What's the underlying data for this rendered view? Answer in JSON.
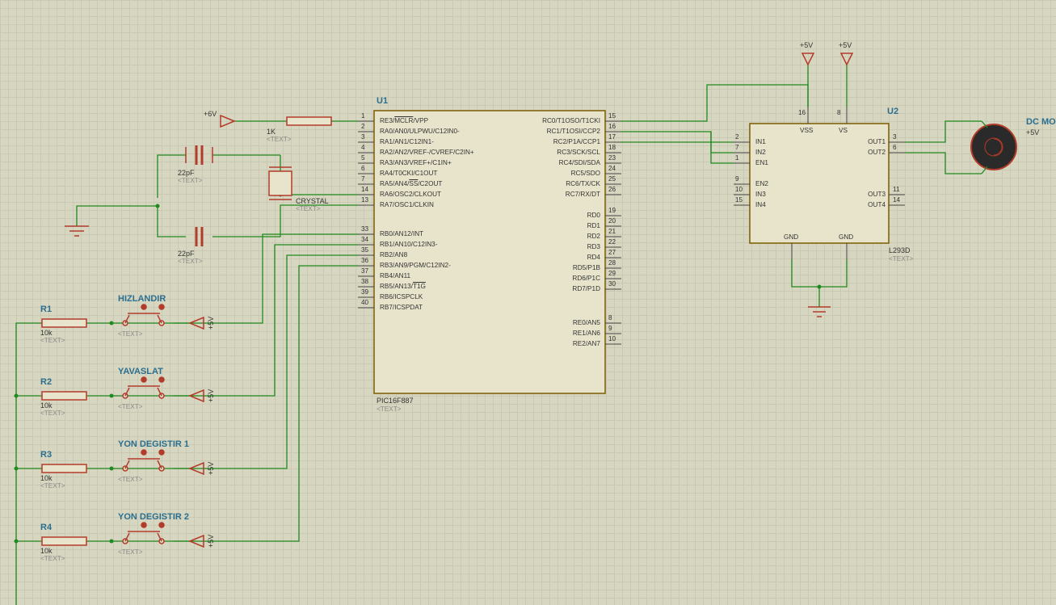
{
  "refs": {
    "U1": "U1",
    "U2": "U2",
    "R1": "R1",
    "R2": "R2",
    "R3": "R3",
    "R4": "R4"
  },
  "values": {
    "U1_part": "PIC16F887",
    "U2_part": "L293D",
    "R_10k": "10k",
    "R_1k": "1K",
    "cap_22pF_top": "22pF",
    "cap_22pF_bot": "22pF",
    "crystal": "CRYSTAL",
    "text_placeholder": "<TEXT>"
  },
  "buttons": {
    "b1": "HIZLANDIR",
    "b2": "YAVASLAT",
    "b3": "YON DEGISTIR 1",
    "b4": "YON DEGISTIR 2"
  },
  "power": {
    "p5v": "+5V",
    "p6v": "+6V"
  },
  "motor": {
    "title": "DC MOTO",
    "sub": "+5V"
  },
  "U1_pins_left": [
    {
      "n": "1",
      "name": "RE3/MCLR/VPP",
      "over": "MCLR"
    },
    {
      "n": "2",
      "name": "RA0/AN0/ULPWU/C12IN0-"
    },
    {
      "n": "3",
      "name": "RA1/AN1/C12IN1-"
    },
    {
      "n": "4",
      "name": "RA2/AN2/VREF-/CVREF/C2IN+"
    },
    {
      "n": "5",
      "name": "RA3/AN3/VREF+/C1IN+"
    },
    {
      "n": "6",
      "name": "RA4/T0CKI/C1OUT"
    },
    {
      "n": "7",
      "name": "RA5/AN4/SS/C2OUT",
      "over": "SS"
    },
    {
      "n": "14",
      "name": "RA6/OSC2/CLKOUT"
    },
    {
      "n": "13",
      "name": "RA7/OSC1/CLKIN"
    },
    {
      "n": "33",
      "name": "RB0/AN12/INT"
    },
    {
      "n": "34",
      "name": "RB1/AN10/C12IN3-"
    },
    {
      "n": "35",
      "name": "RB2/AN8"
    },
    {
      "n": "36",
      "name": "RB3/AN9/PGM/C12IN2-"
    },
    {
      "n": "37",
      "name": "RB4/AN11"
    },
    {
      "n": "38",
      "name": "RB5/AN13/T1G",
      "over": "T1G"
    },
    {
      "n": "39",
      "name": "RB6/ICSPCLK"
    },
    {
      "n": "40",
      "name": "RB7/ICSPDAT"
    }
  ],
  "U1_pins_right": [
    {
      "n": "15",
      "name": "RC0/T1OSO/T1CKI"
    },
    {
      "n": "16",
      "name": "RC1/T1OSI/CCP2"
    },
    {
      "n": "17",
      "name": "RC2/P1A/CCP1"
    },
    {
      "n": "18",
      "name": "RC3/SCK/SCL"
    },
    {
      "n": "23",
      "name": "RC4/SDI/SDA"
    },
    {
      "n": "24",
      "name": "RC5/SDO"
    },
    {
      "n": "25",
      "name": "RC6/TX/CK"
    },
    {
      "n": "26",
      "name": "RC7/RX/DT"
    },
    {
      "n": "19",
      "name": "RD0"
    },
    {
      "n": "20",
      "name": "RD1"
    },
    {
      "n": "21",
      "name": "RD2"
    },
    {
      "n": "22",
      "name": "RD3"
    },
    {
      "n": "27",
      "name": "RD4"
    },
    {
      "n": "28",
      "name": "RD5/P1B"
    },
    {
      "n": "29",
      "name": "RD6/P1C"
    },
    {
      "n": "30",
      "name": "RD7/P1D"
    },
    {
      "n": "8",
      "name": "RE0/AN5"
    },
    {
      "n": "9",
      "name": "RE1/AN6"
    },
    {
      "n": "10",
      "name": "RE2/AN7"
    }
  ],
  "U2_pins_left": [
    {
      "n": "2",
      "name": "IN1"
    },
    {
      "n": "7",
      "name": "IN2"
    },
    {
      "n": "1",
      "name": "EN1"
    },
    {
      "n": "9",
      "name": "EN2"
    },
    {
      "n": "10",
      "name": "IN3"
    },
    {
      "n": "15",
      "name": "IN4"
    }
  ],
  "U2_pins_right": [
    {
      "n": "3",
      "name": "OUT1"
    },
    {
      "n": "6",
      "name": "OUT2"
    },
    {
      "n": "11",
      "name": "OUT3"
    },
    {
      "n": "14",
      "name": "OUT4"
    }
  ],
  "U2_top": [
    {
      "n": "16",
      "name": "VSS"
    },
    {
      "n": "8",
      "name": "VS"
    }
  ],
  "U2_bot": [
    {
      "name": "GND"
    },
    {
      "name": "GND"
    }
  ]
}
